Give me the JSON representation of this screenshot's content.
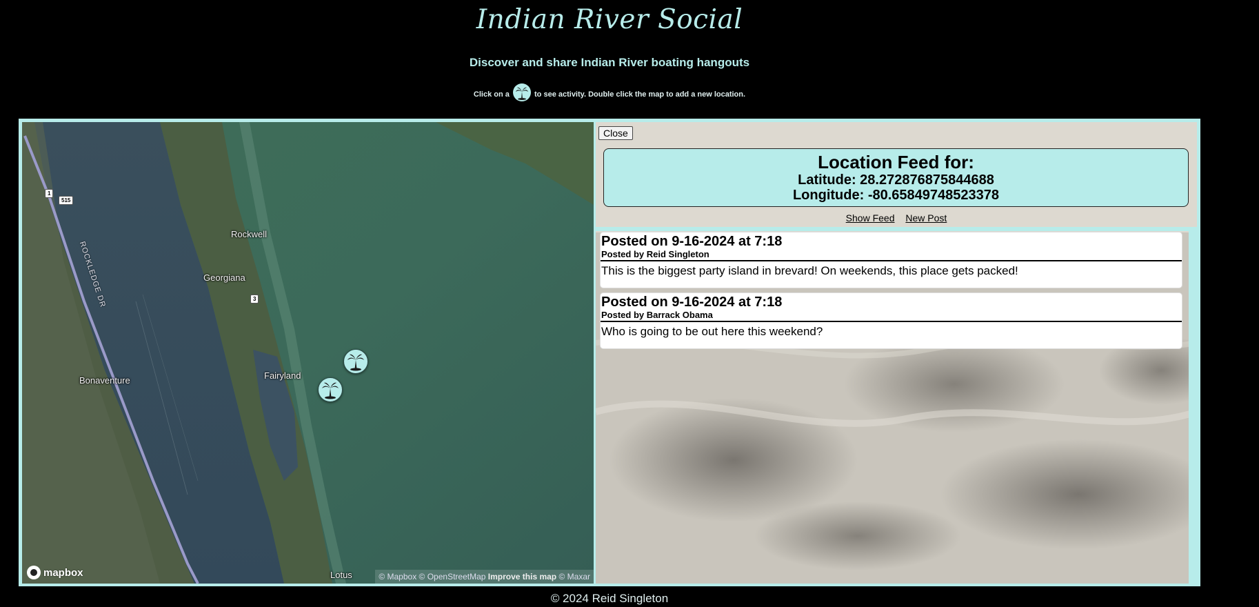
{
  "header": {
    "title": "Indian River Social",
    "subtitle": "Discover and share Indian River boating hangouts",
    "instructions_before": "Click on a",
    "instructions_after": "to see activity. Double click the map to add a new location."
  },
  "map": {
    "place_labels": [
      "Rockwell",
      "Georgiana",
      "Bonaventure",
      "Fairyland",
      "Lotus"
    ],
    "road_label": "ROCKLEDGE DR",
    "shields": [
      "1",
      "515",
      "3"
    ],
    "logo_text": "mapbox",
    "attribution": {
      "mapbox": "© Mapbox",
      "osm": "© OpenStreetMap",
      "improve": "Improve this map",
      "maxar": "© Maxar"
    },
    "marker_icon": "palm-tree-icon",
    "marker_count": 2
  },
  "feed": {
    "close_label": "Close",
    "header_title": "Location Feed for:",
    "latitude_label": "Latitude: 28.272876875844688",
    "longitude_label": "Longitude: -80.65849748523378",
    "show_feed_label": "Show Feed",
    "new_post_label": "New Post",
    "posts": [
      {
        "date": "Posted on  9-16-2024 at 7:18",
        "author": "Posted by Reid Singleton",
        "body": "This is the biggest party island in brevard! On weekends, this place gets packed!"
      },
      {
        "date": "Posted on  9-16-2024 at 7:18",
        "author": "Posted by Barrack Obama",
        "body": "Who is going to be out here this weekend?"
      }
    ]
  },
  "footer": {
    "copyright": "© 2024 Reid Singleton"
  },
  "colors": {
    "accent": "#b7ecea",
    "background": "#000000"
  }
}
